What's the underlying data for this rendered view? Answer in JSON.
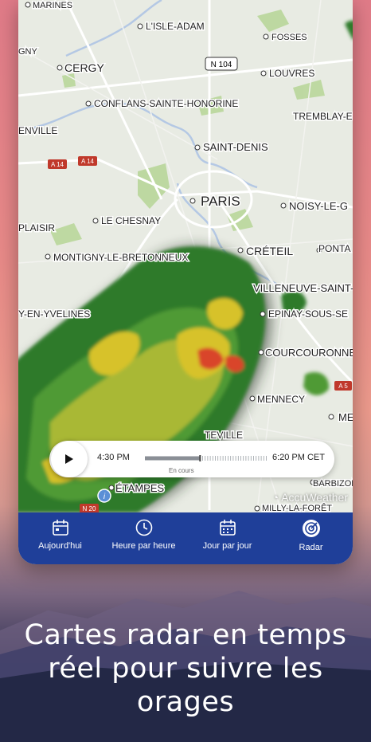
{
  "map": {
    "places": {
      "marines": "MARINES",
      "lisle_adam": "L'ISLE-ADAM",
      "gny": "GNY",
      "fosses": "FOSSES",
      "cergy": "CERGY",
      "n104": "N 104",
      "louvres": "LOUVRES",
      "conflans": "CONFLANS-SAINTE-HONORINE",
      "enville": "ENVILLE",
      "tremblay": "TREMBLAY-E",
      "saint_denis": "SAINT-DENIS",
      "a14a": "A 14",
      "a14b": "A 14",
      "paris": "PARIS",
      "noisy": "NOISY-LE-G",
      "le_chesnay": "LE CHESNAY",
      "plaisir": "PLAISIR",
      "creteil": "CRÉTEIL",
      "ponta": "PONTA",
      "montigny": "MONTIGNY-LE-BRETONNEUX",
      "villeneuve": "VILLENEUVE-SAINT-G",
      "yvelines": "Y-EN-YVELINES",
      "epinay": "EPINAY-SOUS-SE",
      "courcouronnes": "COURCOURONNES",
      "a5": "A 5",
      "mennecy": "MENNECY",
      "me": "ME",
      "teville": "TEVILLE",
      "barbizon": "BARBIZON",
      "etampes": "ÉTAMPES",
      "n20": "N 20",
      "milly": "MILLY-LA-FORÊT"
    },
    "attribution": "AccuWeather"
  },
  "timeline": {
    "start_time": "4:30 PM",
    "end_time": "6:20 PM CET",
    "caption": "En cours",
    "progress": 0.45
  },
  "nav": {
    "items": [
      {
        "label": "Aujourd'hui",
        "icon": "calendar-day-icon"
      },
      {
        "label": "Heure par heure",
        "icon": "clock-icon"
      },
      {
        "label": "Jour par jour",
        "icon": "calendar-icon"
      },
      {
        "label": "Radar",
        "icon": "radar-icon"
      }
    ],
    "active_index": 3
  },
  "tagline": {
    "line1": "Cartes radar en temps",
    "line2": "réel pour suivre les",
    "line3": "orages"
  },
  "colors": {
    "nav_bg": "#1f3f99",
    "radar_green": "#2f7a2a",
    "radar_yellow": "#d7c22a",
    "radar_red": "#d9442a"
  }
}
